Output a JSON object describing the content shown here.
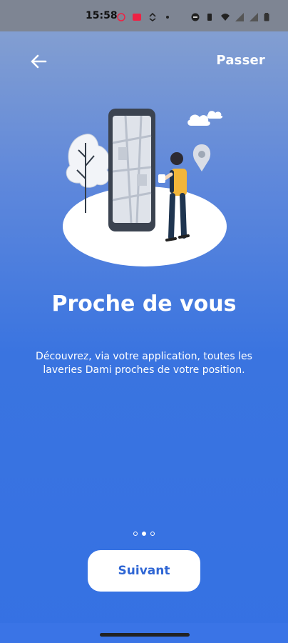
{
  "status_bar": {
    "time": "15:58",
    "icons": [
      "notification-icon",
      "cast-icon",
      "sync-icon",
      "dot-icon",
      "dnd-icon",
      "vibrate-icon",
      "wifi-icon",
      "signal-icon",
      "signal-icon-2",
      "battery-icon"
    ]
  },
  "nav": {
    "skip_label": "Passer"
  },
  "content": {
    "title": "Proche de vous",
    "subtitle": "Découvrez, via votre application, toutes les laveries Dami proches de votre position."
  },
  "pager": {
    "total": 3,
    "active_index": 2
  },
  "actions": {
    "next_label": "Suivant"
  },
  "colors": {
    "brand_blue": "#3571e3",
    "button_text": "#2f66d4"
  }
}
